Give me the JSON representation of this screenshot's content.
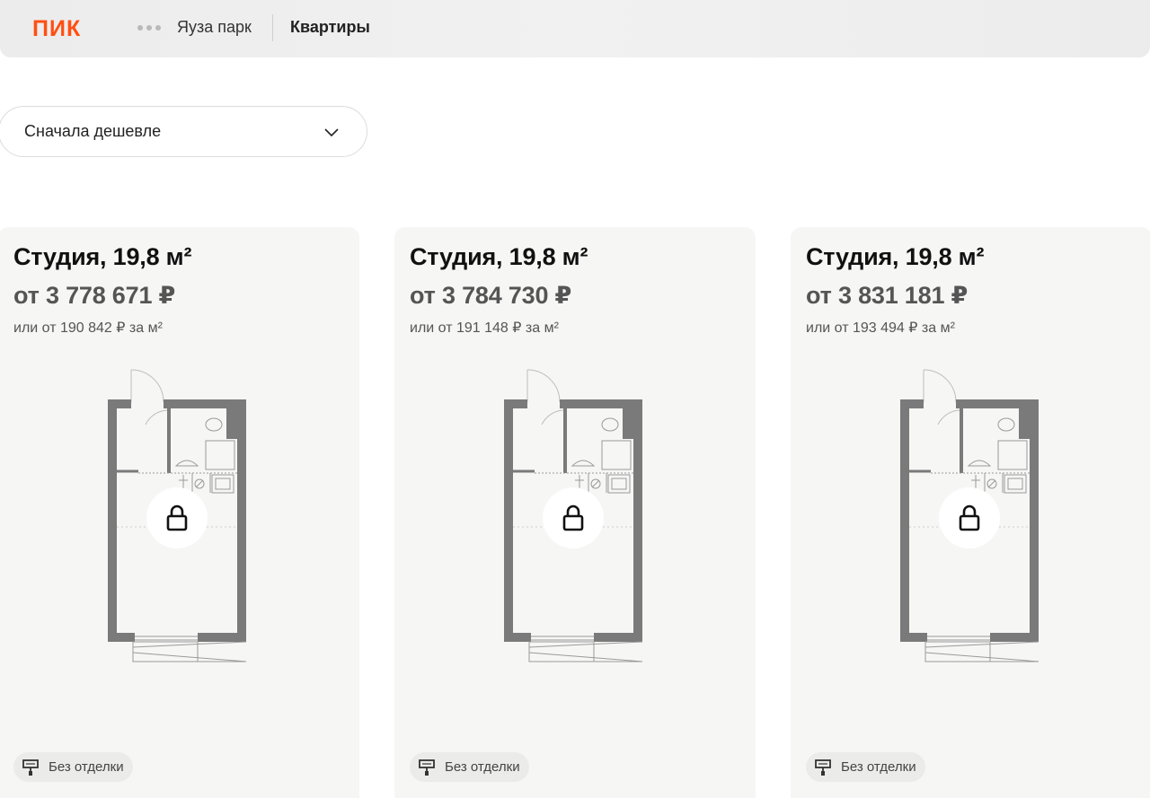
{
  "header": {
    "logo": "ПИК",
    "breadcrumb": "Яуза парк",
    "current": "Квартиры"
  },
  "sort": {
    "label": "Сначала дешевле"
  },
  "cards": [
    {
      "title": "Студия, 19,8 м²",
      "price": "от 3 778 671 ₽",
      "price_per_m2": "или от 190 842 ₽ за м²",
      "finish": "Без отделки"
    },
    {
      "title": "Студия, 19,8 м²",
      "price": "от 3 784 730 ₽",
      "price_per_m2": "или от 191 148 ₽ за м²",
      "finish": "Без отделки"
    },
    {
      "title": "Студия, 19,8 м²",
      "price": "от 3 831 181 ₽",
      "price_per_m2": "или от 193 494 ₽ за м²",
      "finish": "Без отделки"
    }
  ],
  "icons": {
    "more": "more-dots-icon",
    "chevron": "chevron-down-icon",
    "lock": "lock-icon",
    "finish": "paint-roller-icon"
  },
  "colors": {
    "brand": "#ff4f12",
    "card_bg": "#f6f6f5",
    "wall": "#7a7a7a"
  }
}
